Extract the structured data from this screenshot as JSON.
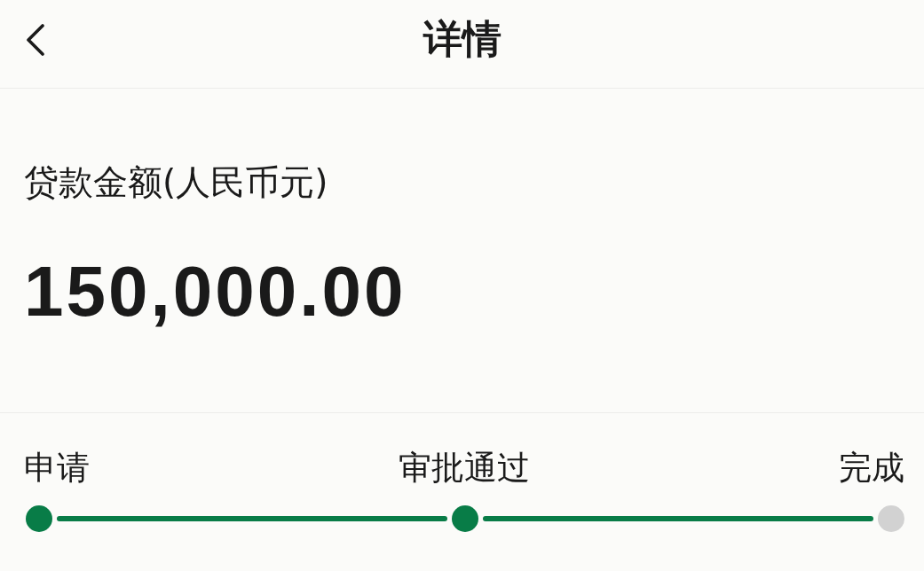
{
  "header": {
    "title": "详情"
  },
  "loan": {
    "label": "贷款金额(人民币元)",
    "amount": "150,000.00"
  },
  "steps": [
    {
      "label": "申请",
      "done": true
    },
    {
      "label": "审批通过",
      "done": true
    },
    {
      "label": "完成",
      "done": false
    }
  ]
}
